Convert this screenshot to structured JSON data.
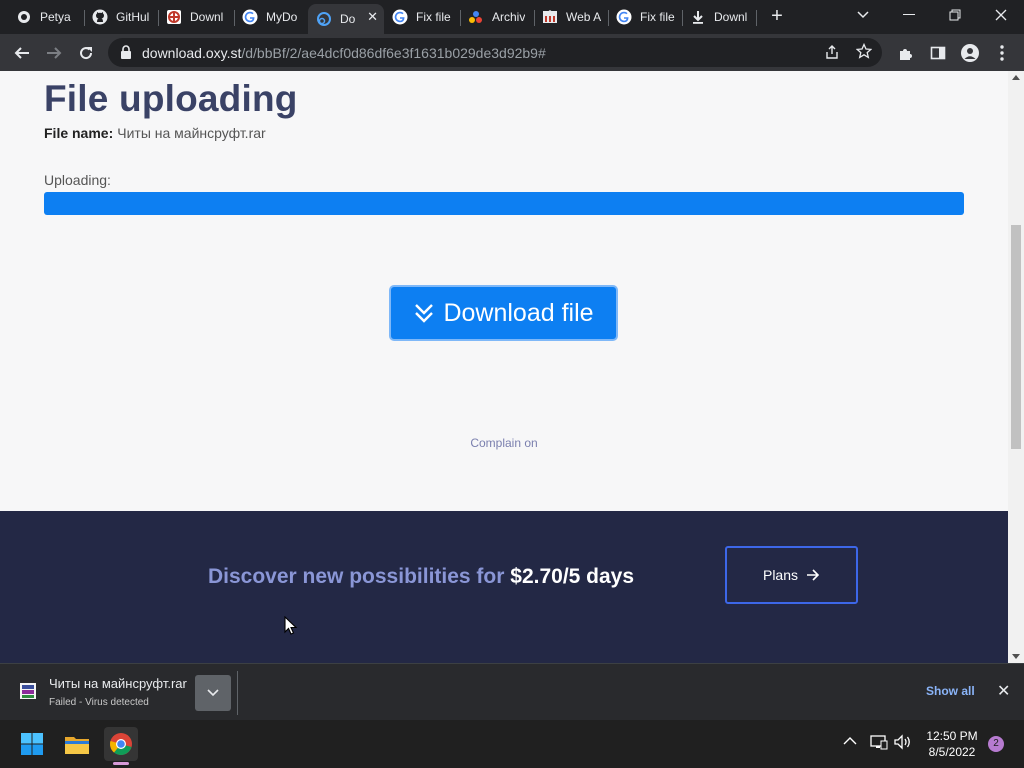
{
  "browser": {
    "tabs": [
      {
        "label": "Petya",
        "icon": "github-circle-icon"
      },
      {
        "label": "GitHul",
        "icon": "github-icon"
      },
      {
        "label": "Downl",
        "icon": "red-cross-icon"
      },
      {
        "label": "MyDo",
        "icon": "google-icon"
      },
      {
        "label": "Do",
        "icon": "oxy-icon",
        "active": true
      },
      {
        "label": "Fix file",
        "icon": "google-icon"
      },
      {
        "label": "Archiv",
        "icon": "archive-dots-icon"
      },
      {
        "label": "Web A",
        "icon": "web-archive-icon"
      },
      {
        "label": "Fix file",
        "icon": "google-icon"
      },
      {
        "label": "Downl",
        "icon": "download-icon"
      }
    ],
    "url_host": "download.oxy.st",
    "url_path": "/d/bbBf/2/ae4dcf0d86df6e3f1631b029de3d92b9#"
  },
  "page": {
    "title": "File uploading",
    "file_name_label": "File name:",
    "file_name": "Читы на майнсруфт.rar",
    "uploading_label": "Uploading:",
    "progress_percent": 100,
    "download_button": "Download file",
    "complain_link": "Complain on",
    "promo_text": "Discover new possibilities for",
    "promo_price": "$2.70/5 days",
    "plans_button": "Plans"
  },
  "download_shelf": {
    "file_name": "Читы на майнсруфт.rar",
    "status": "Failed - Virus detected",
    "show_all": "Show all"
  },
  "taskbar": {
    "time": "12:50 PM",
    "date": "8/5/2022",
    "notifications": "2"
  },
  "colors": {
    "accent": "#0d7ff2",
    "heading": "#3a4266",
    "promo_bg": "#232845"
  }
}
